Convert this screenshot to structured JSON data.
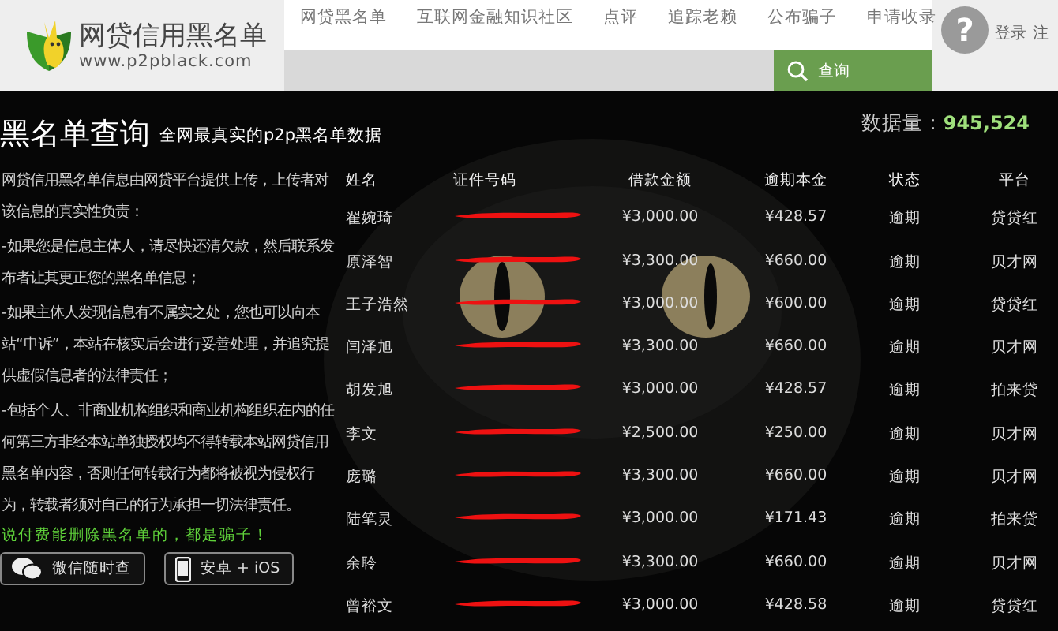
{
  "header": {
    "logo_title": "网贷信用黑名单",
    "logo_url": "www.p2pblack.com",
    "nav": [
      {
        "label": "网贷黑名单"
      },
      {
        "label": "互联网金融知识社区"
      },
      {
        "label": "点评"
      },
      {
        "label": "追踪老赖"
      },
      {
        "label": "公布骗子"
      },
      {
        "label": "申请收录"
      }
    ],
    "search_button": "查询",
    "help_icon": "?",
    "login": "登录",
    "register": "注"
  },
  "title": "黑名单查询",
  "subtitle": "全网最真实的p2p黑名单数据",
  "count_label": "数据量：",
  "count_value": "945,524",
  "notice": [
    "网贷信用黑名单信息由网贷平台提供上传，上传者对该信息的真实性负责：",
    "-如果您是信息主体人，请尽快还清欠款，然后联系发布者让其更正您的黑名单信息；",
    "-如果主体人发现信息有不属实之处，您也可以向本站“申诉”，本站在核实后会进行妥善处理，并追究提供虚假信息者的法律责任；",
    "-包括个人、非商业机构组织和商业机构组织在内的任何第三方非经本站单独授权均不得转载本站网贷信用黑名单内容，否则任何转载行为都将被视为侵权行为，转载者须对自己的行为承担一切法律责任。"
  ],
  "warning": "说付费能删除黑名单的，都是骗子！",
  "apps": [
    {
      "kind": "wechat",
      "label": "微信随时查"
    },
    {
      "kind": "phone",
      "label": "安卓 + iOS"
    }
  ],
  "table": {
    "columns": [
      "姓名",
      "证件号码",
      "借款金额",
      "逾期本金",
      "状态",
      "平台"
    ],
    "rows": [
      {
        "name": "翟婉琦",
        "id_redacted": true,
        "amount": "¥3,000.00",
        "overdue": "¥428.57",
        "status": "逾期",
        "platform": "贷贷红"
      },
      {
        "name": "原泽智",
        "id_redacted": true,
        "amount": "¥3,300.00",
        "overdue": "¥660.00",
        "status": "逾期",
        "platform": "贝才网"
      },
      {
        "name": "王子浩然",
        "id_redacted": true,
        "amount": "¥3,000.00",
        "overdue": "¥600.00",
        "status": "逾期",
        "platform": "贷贷红"
      },
      {
        "name": "闫泽旭",
        "id_redacted": true,
        "amount": "¥3,300.00",
        "overdue": "¥660.00",
        "status": "逾期",
        "platform": "贝才网"
      },
      {
        "name": "胡发旭",
        "id_redacted": true,
        "amount": "¥3,000.00",
        "overdue": "¥428.57",
        "status": "逾期",
        "platform": "拍来贷"
      },
      {
        "name": "李文",
        "id_redacted": true,
        "amount": "¥2,500.00",
        "overdue": "¥250.00",
        "status": "逾期",
        "platform": "贝才网"
      },
      {
        "name": "庞璐",
        "id_redacted": true,
        "amount": "¥3,300.00",
        "overdue": "¥660.00",
        "status": "逾期",
        "platform": "贝才网"
      },
      {
        "name": "陆笔灵",
        "id_redacted": true,
        "amount": "¥3,000.00",
        "overdue": "¥171.43",
        "status": "逾期",
        "platform": "拍来贷"
      },
      {
        "name": "余聆",
        "id_redacted": true,
        "amount": "¥3,300.00",
        "overdue": "¥660.00",
        "status": "逾期",
        "platform": "贝才网"
      },
      {
        "name": "曾裕文",
        "id_redacted": true,
        "amount": "¥3,000.00",
        "overdue": "¥428.58",
        "status": "逾期",
        "platform": "贷贷红"
      }
    ]
  }
}
